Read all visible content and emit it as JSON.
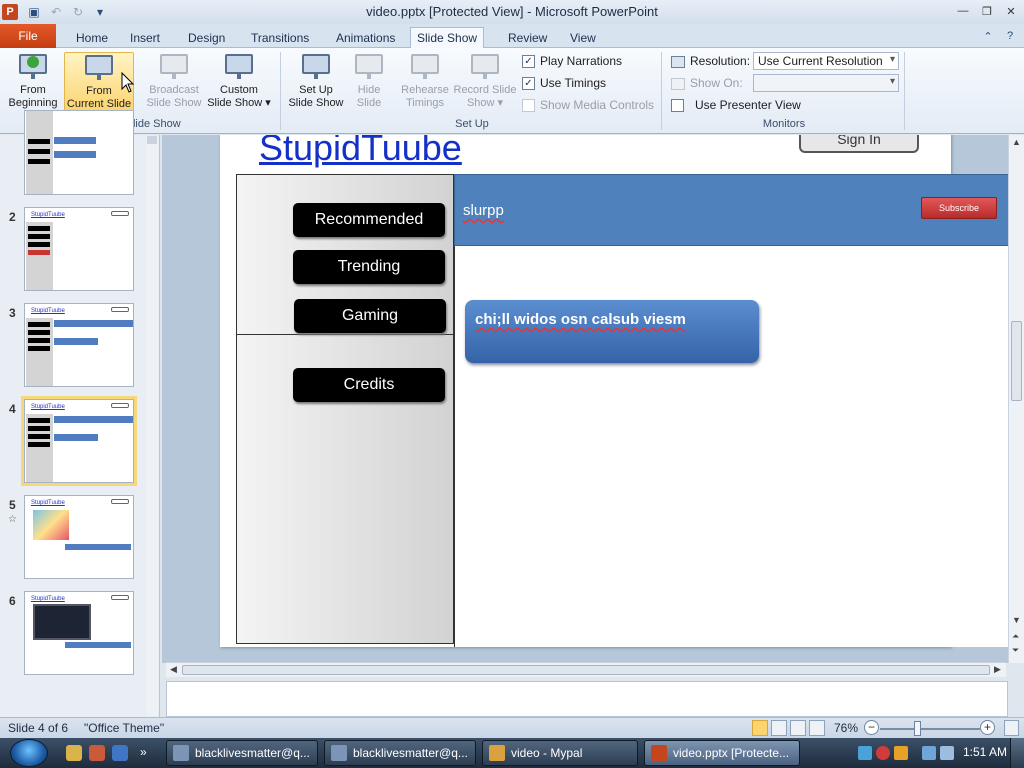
{
  "window": {
    "title": "video.pptx [Protected View] - Microsoft PowerPoint",
    "app_icon_letter": "P"
  },
  "quick_access": [
    "save-icon",
    "undo-icon",
    "redo-icon",
    "customize-icon"
  ],
  "tabs": {
    "file": "File",
    "items": [
      "Home",
      "Insert",
      "Design",
      "Transitions",
      "Animations",
      "Slide Show",
      "Review",
      "View"
    ],
    "active": "Slide Show"
  },
  "ribbon": {
    "start": {
      "from_beginning": [
        "From",
        "Beginning"
      ],
      "from_current": [
        "From",
        "Current Slide"
      ],
      "broadcast": [
        "Broadcast",
        "Slide Show"
      ],
      "custom": [
        "Custom",
        "Slide Show ▾"
      ],
      "label": "Start Slide Show"
    },
    "setup": {
      "setup_show": [
        "Set Up",
        "Slide Show"
      ],
      "hide_slide": [
        "Hide",
        "Slide"
      ],
      "rehearse": [
        "Rehearse",
        "Timings"
      ],
      "record": [
        "Record Slide",
        "Show ▾"
      ],
      "play_narrations": "Play Narrations",
      "use_timings": "Use Timings",
      "show_media": "Show Media Controls",
      "label": "Set Up"
    },
    "monitors": {
      "resolution_label": "Resolution:",
      "resolution_value": "Use Current Resolution",
      "show_on_label": "Show On:",
      "presenter_view": "Use Presenter View",
      "label": "Monitors"
    }
  },
  "thumbnails": {
    "numbers": [
      "2",
      "3",
      "4",
      "5",
      "6"
    ],
    "title_text": "StupidTuube"
  },
  "slide": {
    "title": "StupidTuube",
    "sign_in": "Sign In",
    "nav": [
      "Recommended",
      "Trending",
      "Gaming",
      "Credits"
    ],
    "channel_name": "slurpp",
    "subscribe": "Subscribe",
    "video_title": "chi;ll widos osn calsub viesm"
  },
  "status": {
    "slide_info": "Slide 4 of 6",
    "theme": "\"Office Theme\"",
    "zoom": "76%"
  },
  "taskbar": {
    "buttons": [
      "blacklivesmatter@q...",
      "blacklivesmatter@q...",
      "video - Mypal",
      "video.pptx [Protecte..."
    ],
    "clock": "1:51 AM"
  }
}
